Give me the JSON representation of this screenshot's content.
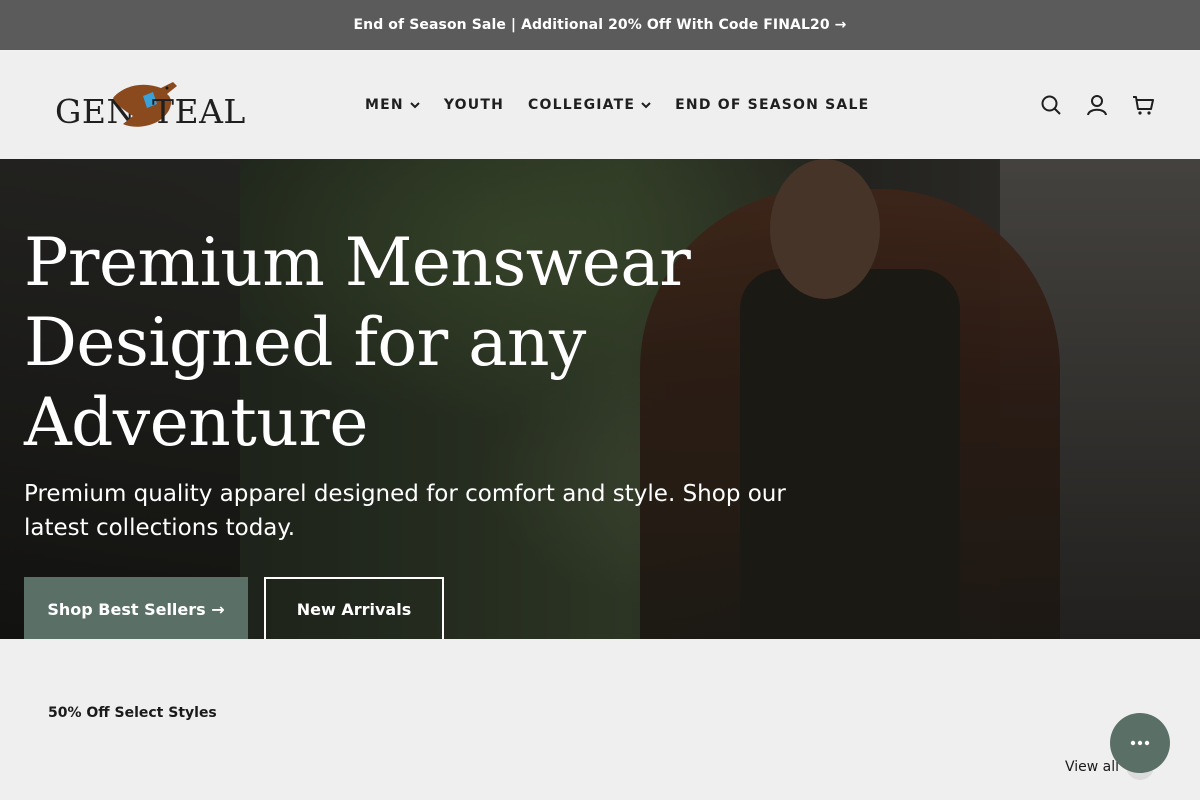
{
  "announcement": {
    "text": "End of Season Sale | Additional 20% Off With Code FINAL20 →"
  },
  "header": {
    "logo": {
      "word_left": "GEN",
      "word_right": "TEAL"
    },
    "nav": [
      {
        "label": "MEN",
        "has_dropdown": true
      },
      {
        "label": "YOUTH",
        "has_dropdown": false
      },
      {
        "label": "COLLEGIATE",
        "has_dropdown": true
      },
      {
        "label": "END OF SEASON SALE",
        "has_dropdown": false
      }
    ],
    "icons": [
      "search-icon",
      "account-icon",
      "cart-icon"
    ]
  },
  "hero": {
    "title_line1": "Premium Menswear",
    "title_line2": "Designed for any Adventure",
    "subtitle": "Premium quality apparel designed for comfort and style. Shop our latest collections today.",
    "primary_button": "Shop Best Sellers →",
    "secondary_button": "New Arrivals"
  },
  "collection": {
    "label": "50% Off Select Styles",
    "view_all": "View all"
  },
  "colors": {
    "announcement_bg": "#5b5b5b",
    "header_bg": "#efefef",
    "accent": "#5a7066",
    "logo_duck_brown": "#8a4a1e",
    "logo_duck_teal": "#3aa0d8"
  }
}
